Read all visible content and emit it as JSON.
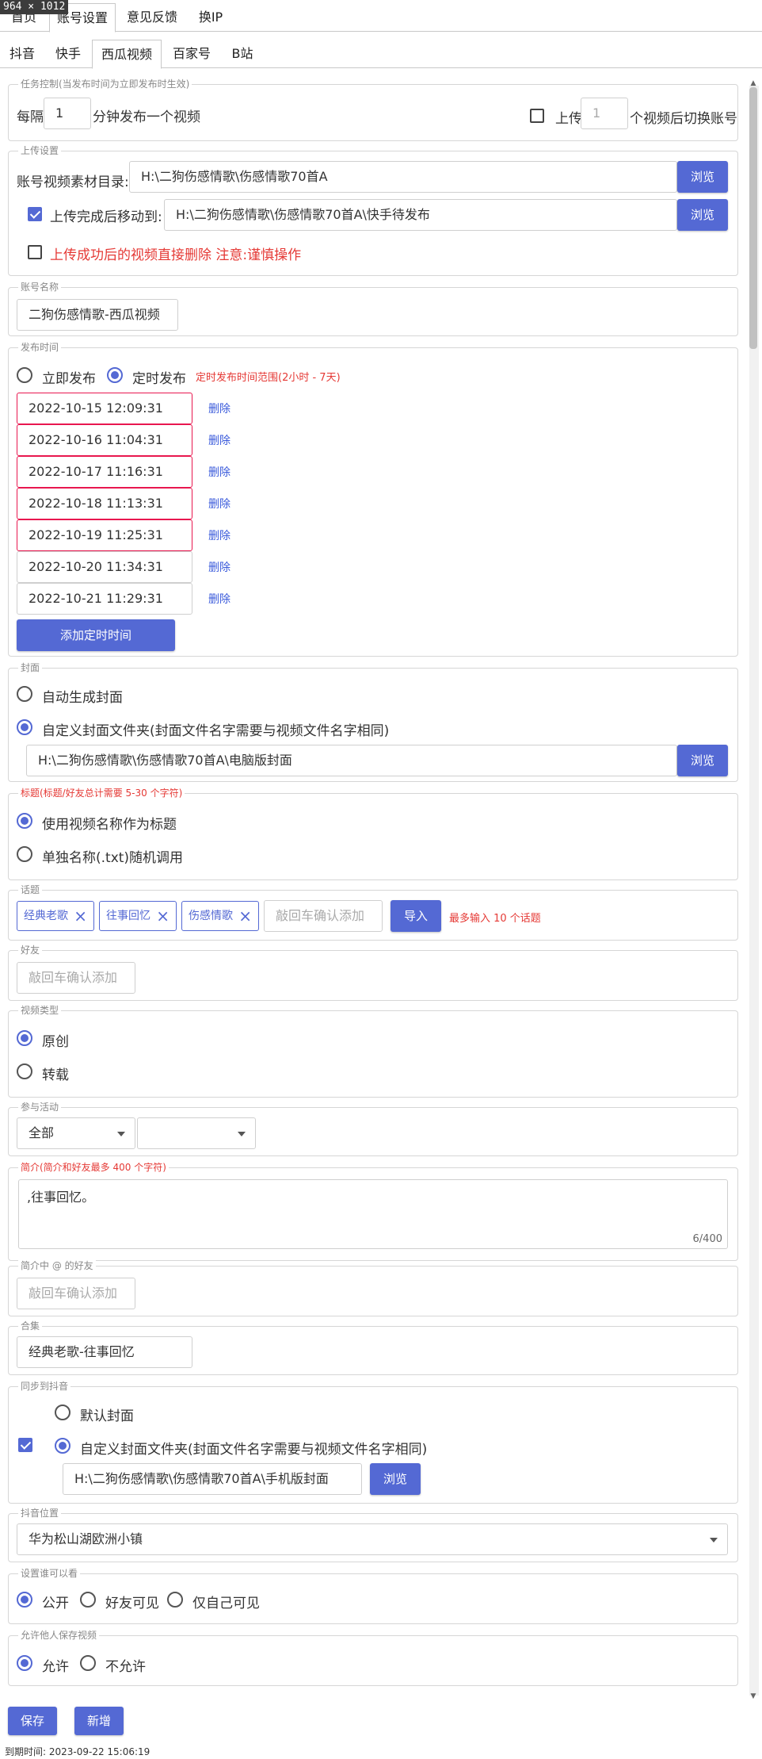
{
  "window": {
    "dimensions_badge": "964 × 1012"
  },
  "top_tabs": [
    {
      "label": "首页"
    },
    {
      "label": "账号设置"
    },
    {
      "label": "意见反馈"
    },
    {
      "label": "换IP"
    }
  ],
  "sub_tabs": [
    {
      "label": "抖音"
    },
    {
      "label": "快手"
    },
    {
      "label": "西瓜视频"
    },
    {
      "label": "百家号"
    },
    {
      "label": "B站"
    }
  ],
  "task_control": {
    "legend": "任务控制(当发布时间为立即发布时生效)",
    "every_label": "每隔",
    "interval_value": "1",
    "interval_suffix": "分钟发布一个视频",
    "switch_checked": false,
    "switch_prefix": "上传",
    "switch_value": "1",
    "switch_suffix": "个视频后切换账号"
  },
  "upload": {
    "legend": "上传设置",
    "dir_label": "账号视频素材目录:",
    "dir_value": "H:\\二狗伤感情歌\\伤感情歌70首A",
    "browse_label": "浏览",
    "move_checked": true,
    "move_label": "上传完成后移动到:",
    "move_value": "H:\\二狗伤感情歌\\伤感情歌70首A\\快手待发布",
    "delete_checked": false,
    "delete_label": "上传成功后的视频直接删除 注意:谨慎操作"
  },
  "account": {
    "legend": "账号名称",
    "value": "二狗伤感情歌-西瓜视频"
  },
  "publish": {
    "legend": "发布时间",
    "immediate_label": "立即发布",
    "scheduled_label": "定时发布",
    "selected": "scheduled",
    "range_hint": "定时发布时间范围(2小时 - 7天)",
    "delete_label": "删除",
    "times": [
      {
        "value": "2022-10-15 12:09:31",
        "error": true
      },
      {
        "value": "2022-10-16 11:04:31",
        "error": true
      },
      {
        "value": "2022-10-17 11:16:31",
        "error": true
      },
      {
        "value": "2022-10-18 11:13:31",
        "error": true
      },
      {
        "value": "2022-10-19 11:25:31",
        "error": true
      },
      {
        "value": "2022-10-20 11:34:31",
        "error": false
      },
      {
        "value": "2022-10-21 11:29:31",
        "error": false
      }
    ],
    "add_label": "添加定时时间"
  },
  "cover": {
    "legend": "封面",
    "auto_label": "自动生成封面",
    "custom_label": "自定义封面文件夹(封面文件名字需要与视频文件名字相同)",
    "selected": "custom",
    "path": "H:\\二狗伤感情歌\\伤感情歌70首A\\电脑版封面",
    "browse_label": "浏览"
  },
  "title": {
    "legend": "标题(标题/好友总计需要 5-30 个字符)",
    "video_name_label": "使用视频名称作为标题",
    "txt_label": "单独名称(.txt)随机调用",
    "selected": "video_name"
  },
  "topics": {
    "legend": "话题",
    "tags": [
      "经典老歌",
      "往事回忆",
      "伤感情歌"
    ],
    "input_placeholder": "敲回车确认添加",
    "import_label": "导入",
    "limit_hint": "最多输入 10 个话题"
  },
  "friends": {
    "legend": "好友",
    "placeholder": "敲回车确认添加"
  },
  "video_type": {
    "legend": "视频类型",
    "original_label": "原创",
    "repost_label": "转载",
    "selected": "original"
  },
  "activity": {
    "legend": "参与活动",
    "select1_value": "全部",
    "select2_value": ""
  },
  "intro": {
    "legend": "简介(简介和好友最多 400 个字符)",
    "value": ",往事回忆。",
    "counter": "6/400"
  },
  "intro_friends": {
    "legend": "简介中 @ 的好友",
    "placeholder": "敲回车确认添加"
  },
  "collection": {
    "legend": "合集",
    "value": "经典老歌-往事回忆"
  },
  "sync_douyin": {
    "legend": "同步到抖音",
    "checked": true,
    "default_label": "默认封面",
    "custom_label": "自定义封面文件夹(封面文件名字需要与视频文件名字相同)",
    "selected": "custom",
    "path": "H:\\二狗伤感情歌\\伤感情歌70首A\\手机版封面",
    "browse_label": "浏览"
  },
  "douyin_location": {
    "legend": "抖音位置",
    "value": "华为松山湖欧洲小镇"
  },
  "visibility": {
    "legend": "设置谁可以看",
    "public_label": "公开",
    "friends_label": "好友可见",
    "private_label": "仅自己可见",
    "selected": "public"
  },
  "allow_save": {
    "legend": "允许他人保存视频",
    "allow_label": "允许",
    "deny_label": "不允许",
    "selected": "allow"
  },
  "actions": {
    "save_label": "保存",
    "new_label": "新增"
  },
  "footer": {
    "expiry": "到期时间: 2023-09-22 15:06:19"
  },
  "colors": {
    "accent": "#5469d4",
    "error": "#e53935",
    "border": "#cfcfcf"
  }
}
